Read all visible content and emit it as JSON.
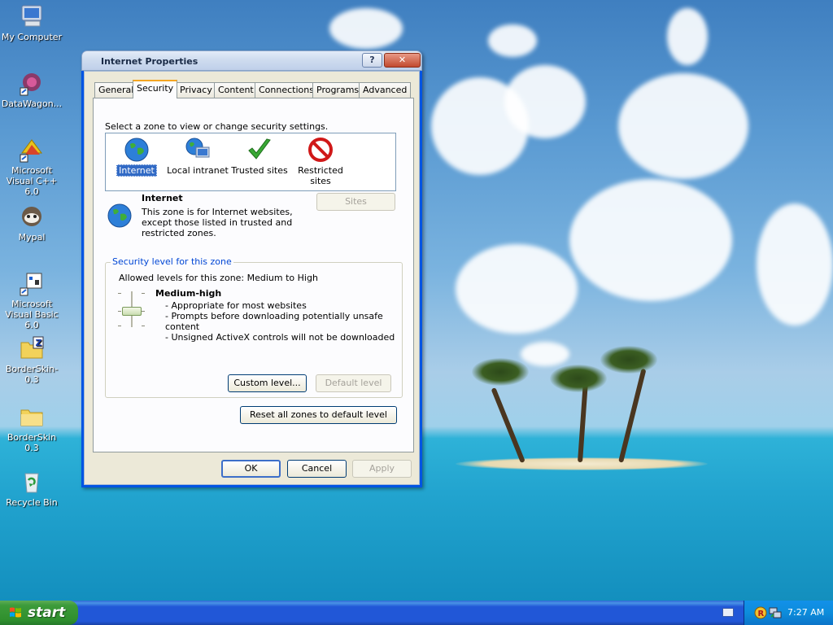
{
  "desktop": {
    "icons": [
      {
        "label": "My Computer"
      },
      {
        "label": "DataWagon..."
      },
      {
        "label": "Microsoft Visual C++ 6.0"
      },
      {
        "label": "Mypal"
      },
      {
        "label": "Microsoft Visual Basic 6.0"
      },
      {
        "label": "BorderSkin-0.3"
      },
      {
        "label": "BorderSkin 0.3"
      },
      {
        "label": "Recycle Bin"
      }
    ]
  },
  "window": {
    "title": "Internet Properties",
    "help_label": "?",
    "close_label": "✕",
    "tabs": [
      {
        "label": "General"
      },
      {
        "label": "Security"
      },
      {
        "label": "Privacy"
      },
      {
        "label": "Content"
      },
      {
        "label": "Connections"
      },
      {
        "label": "Programs"
      },
      {
        "label": "Advanced"
      }
    ],
    "active_tab": "Security",
    "security": {
      "instruction": "Select a zone to view or change security settings.",
      "zones": [
        {
          "label": "Internet",
          "icon": "globe-icon"
        },
        {
          "label": "Local intranet",
          "icon": "intranet-icon"
        },
        {
          "label": "Trusted sites",
          "icon": "checkmark-icon"
        },
        {
          "label": "Restricted sites",
          "icon": "restricted-icon"
        }
      ],
      "selected_zone": "Internet",
      "zone_name": "Internet",
      "zone_description_lines": [
        "This zone is for Internet websites,",
        "except those listed in trusted and",
        "restricted zones."
      ],
      "sites_button": "Sites",
      "group_title": "Security level for this zone",
      "allowed_levels": "Allowed levels for this zone: Medium to High",
      "level_name": "Medium-high",
      "level_bullets": [
        "- Appropriate for most websites",
        "- Prompts before downloading potentially unsafe",
        "content",
        "- Unsigned ActiveX controls will not be downloaded"
      ],
      "custom_level_button": "Custom level...",
      "default_level_button": "Default level",
      "reset_button": "Reset all zones to default level"
    },
    "buttons": {
      "ok": "OK",
      "cancel": "Cancel",
      "apply": "Apply"
    }
  },
  "taskbar": {
    "start_label": "start",
    "clock": "7:27 AM"
  },
  "colors": {
    "selection": "#316ac5",
    "groupbox_title": "#0046d5",
    "taskbar_blue": "#2157d7",
    "start_green": "#3c9b3a"
  }
}
